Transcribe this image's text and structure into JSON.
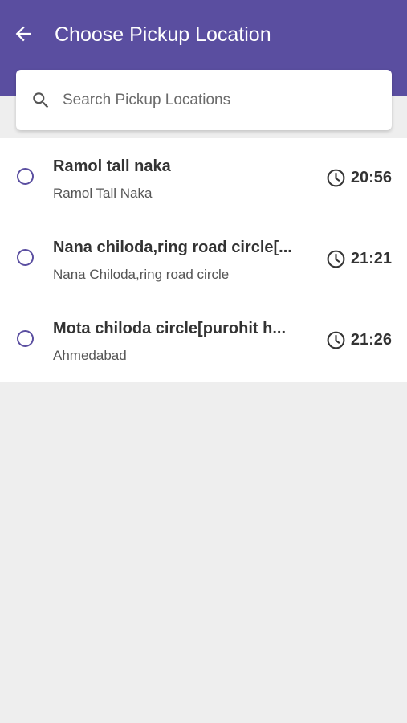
{
  "header": {
    "title": "Choose Pickup Location",
    "back_icon": "arrow-left-icon",
    "background": "#5a4ea0"
  },
  "search": {
    "placeholder": "Search Pickup Locations",
    "value": "",
    "icon": "search-icon"
  },
  "locations": [
    {
      "name": "Ramol tall naka",
      "address": "Ramol Tall Naka",
      "time": "20:56",
      "selected": false
    },
    {
      "name": "Nana chiloda,ring road circle[...",
      "address": "Nana Chiloda,ring road circle",
      "time": "21:21",
      "selected": false
    },
    {
      "name": "Mota chiloda circle[purohit h...",
      "address": "Ahmedabad",
      "time": "21:26",
      "selected": false
    }
  ],
  "colors": {
    "accent": "#5a4ea0",
    "page_background": "#eeeeee"
  }
}
